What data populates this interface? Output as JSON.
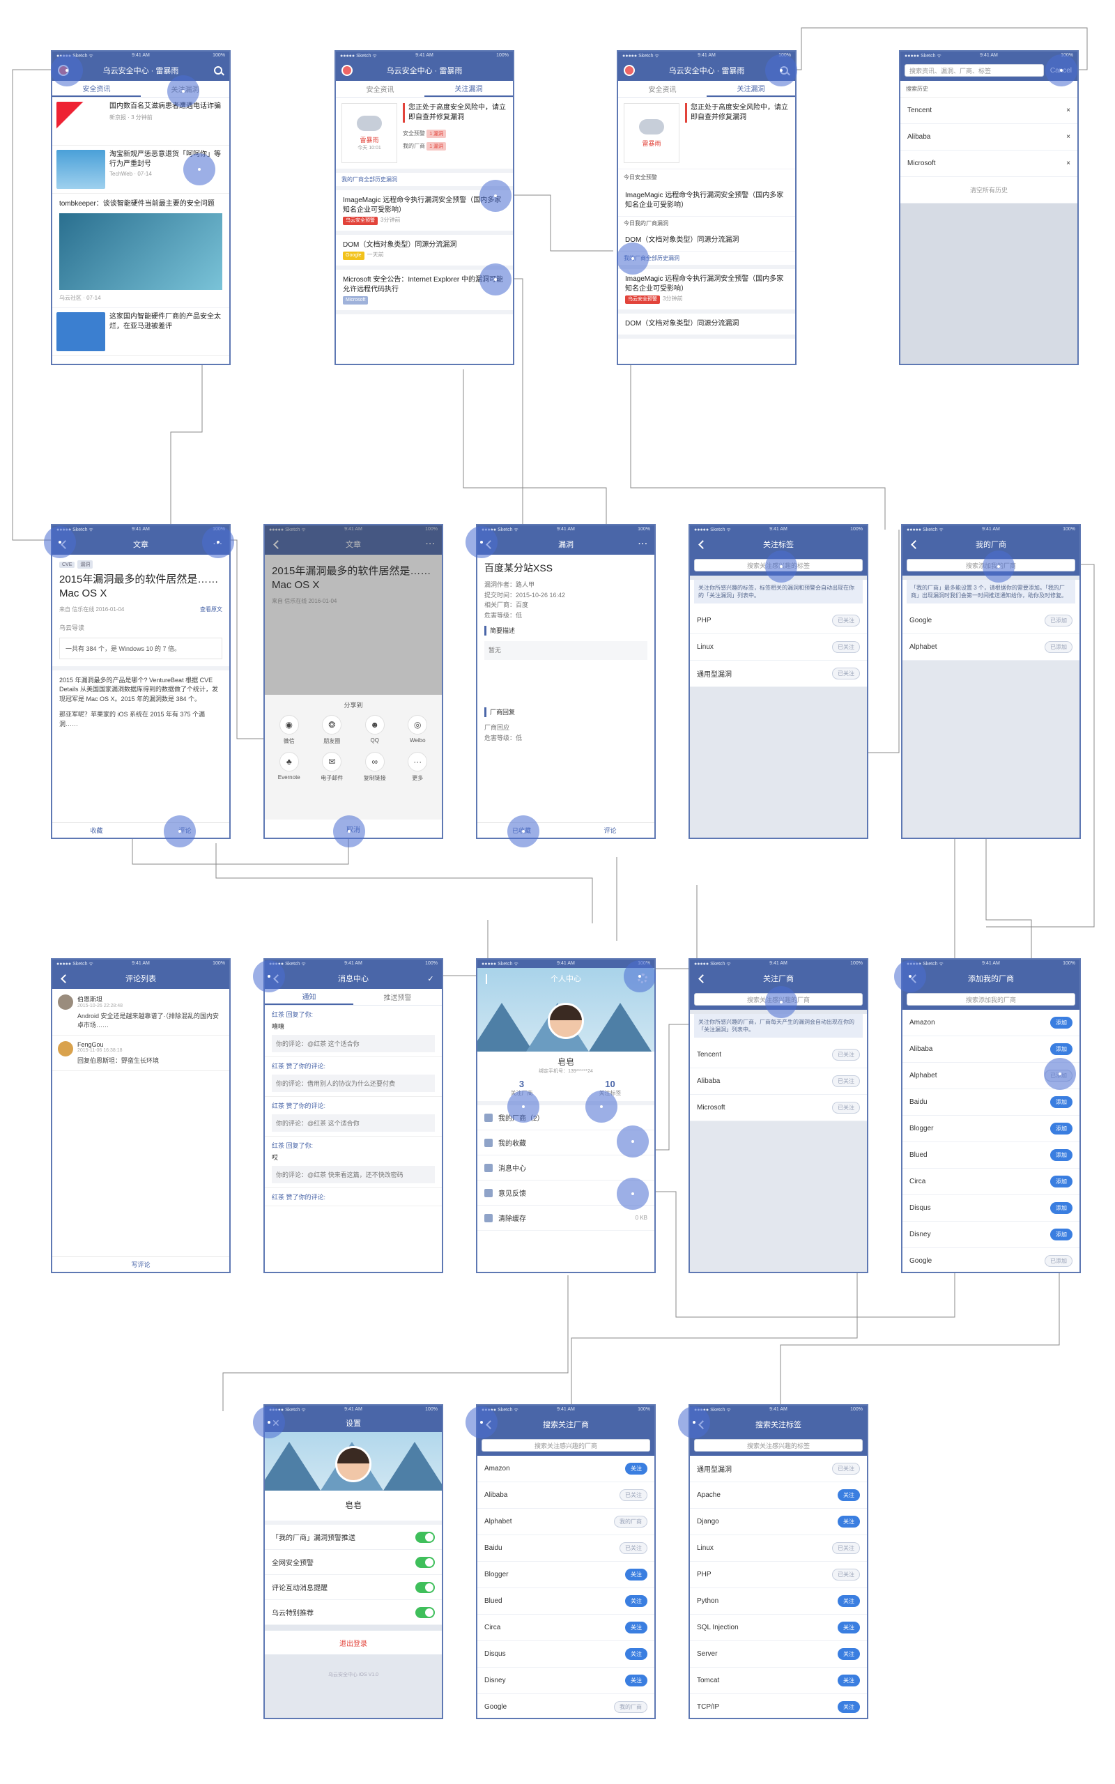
{
  "status": {
    "carrier": "●●●●● Sketch ᯤ",
    "time": "9:41 AM",
    "battery": "100%"
  },
  "home": {
    "title": "乌云安全中心 · 雷暴雨",
    "tabs": [
      "安全资讯",
      "关注漏洞"
    ],
    "feed": [
      {
        "text": "国内数百名艾滋病患者遭遇电话诈骗",
        "meta": "新京报 · 3 分钟前"
      },
      {
        "text": "淘宝新规严惩恶意退货「呵呵你」等行为严重封号",
        "meta": "TechWeb · 07-14"
      },
      {
        "text": "tombkeeper：谈谈智能硬件当前最主要的安全问题",
        "meta": "乌云社区 · 07-14"
      },
      {
        "text": "这家国内智能硬件厂商的产品安全太烂，在亚马逊被差评",
        "meta": ""
      }
    ]
  },
  "watch": {
    "title": "乌云安全中心 · 雷暴雨",
    "tabs": [
      "安全资讯",
      "关注漏洞"
    ],
    "alert": {
      "level": "雷暴雨",
      "date": "今天 10:01",
      "text": "您正处于高度安全风险中，请立即自查并修复漏洞",
      "rows": [
        "安全预警",
        "我的厂商"
      ],
      "badges": [
        "1 漏洞",
        "1 漏洞"
      ]
    },
    "history": "我的厂商全部历史漏洞",
    "items": [
      {
        "title": "ImageMagic 远程命令执行漏洞安全预警（国内多家知名企业可受影响）",
        "tag": "乌云安全预警",
        "time": "3分钟前"
      },
      {
        "title": "DOM（文档对象类型）同源分流漏洞",
        "tag": "Google",
        "time": "一天前"
      },
      {
        "title": "Microsoft 安全公告：Internet Explorer 中的漏洞可能允许远程代码执行",
        "tag": "Microsoft",
        "time": "一天前"
      }
    ],
    "today": "今日安全预警",
    "today2": "今日我的厂商漏洞"
  },
  "search": {
    "placeholder": "搜索资讯、漏洞、厂商、标签",
    "cancel": "Cancel",
    "history_label": "搜索历史",
    "history": [
      "Tencent",
      "Alibaba",
      "Microsoft"
    ],
    "clear": "清空所有历史"
  },
  "article": {
    "title": "文章",
    "tags": [
      "CVE",
      "漏洞"
    ],
    "headline": "2015年漏洞最多的软件居然是……Mac OS X",
    "source": "来自 信乐在线 2016-01-04",
    "view_orig": "查看原文",
    "guide": "乌云导读",
    "quote": "一共有 384 个，是 Windows 10 的 7 倍。",
    "body": "2015 年漏洞最多的产品是哪个? VentureBeat 根据 CVE Details 从美国国家漏洞数据库得到的数据做了个统计，发现冠军是 Mac OS X。2015 年的漏洞数是 384 个。",
    "body2": "那亚军呢？苹果家的 iOS 系统在 2015 年有 375 个漏洞……",
    "fav": "收藏",
    "comment": "评论"
  },
  "share": {
    "title": "分享到",
    "items": [
      "微信",
      "朋友圈",
      "QQ",
      "Weibo",
      "Evernote",
      "电子邮件",
      "复制链接",
      "更多"
    ],
    "cancel": "取消"
  },
  "vuln": {
    "title": "漏洞",
    "name": "百度某分站XSS",
    "author": "漏洞作者：路人甲",
    "time": "提交时间：2015-10-26 16:42",
    "vendor": "相关厂商：百度",
    "level": "危害等级：低",
    "desc_label": "简要描述",
    "desc": "暂无",
    "reply_label": "厂商回复",
    "reply": "厂商回应",
    "level2": "危害等级：低",
    "fav": "已收藏",
    "comment": "评论"
  },
  "tags": {
    "title": "关注标签",
    "search": "搜索关注感兴趣的标签",
    "note": "关注你所感兴趣的标签，标签相关的漏洞和预警会自动出现在你的「关注漏洞」列表中。",
    "rows": [
      {
        "n": "PHP",
        "s": "已关注"
      },
      {
        "n": "Linux",
        "s": "已关注"
      },
      {
        "n": "通用型漏洞",
        "s": "已关注"
      }
    ]
  },
  "vendors": {
    "title": "我的厂商",
    "search": "搜索添加我的厂商",
    "note": "「我的厂商」最多能设置 3 个，请根据你的需要添加。「我的厂商」出现漏洞时我们会第一时间推送通知给你，助你及时修复。",
    "rows": [
      {
        "n": "Google",
        "s": "已添加"
      },
      {
        "n": "Alphabet",
        "s": "已添加"
      }
    ]
  },
  "comments": {
    "title": "评论列表",
    "items": [
      {
        "user": "伯恩斯坦",
        "date": "2015-10-26 22:28:48",
        "text": "Android 安全还是越来越靠谱了·（排除混乱的国内安卓市场……"
      },
      {
        "user": "FengGou",
        "date": "2015-11-06 16:38:18",
        "text": "回复伯恩斯坦：野蛮生长环境"
      }
    ],
    "write": "写评论"
  },
  "messages": {
    "title": "消息中心",
    "tabs": [
      "通知",
      "推送预警"
    ],
    "items": [
      {
        "h": "红茶 回复了你:",
        "r": "嘻嘻",
        "b": "你的评论：@红茶 这个适合你"
      },
      {
        "h": "红茶 赞了你的评论:",
        "r": "",
        "b": "你的评论：借用别人的协议为什么还要付费"
      },
      {
        "h": "红茶 赞了你的评论:",
        "r": "",
        "b": "你的评论：@红茶 这个适合你"
      },
      {
        "h": "红茶 回复了你:",
        "r": "哎",
        "b": "你的评论：@红茶 快来看这篇，还不快改密码"
      },
      {
        "h": "红茶 赞了你的评论:",
        "r": "",
        "b": ""
      }
    ]
  },
  "profile": {
    "title": "个人中心",
    "name": "皂皂",
    "phone": "绑定手机号：139******24",
    "stats": [
      {
        "n": "3",
        "l": "关注厂商"
      },
      {
        "n": "10",
        "l": "关注标签"
      }
    ],
    "menu": [
      "我的厂商（2）",
      "我的收藏",
      "消息中心",
      "意见反馈",
      "清除缓存"
    ],
    "cache": "0 KB"
  },
  "focus_vendors": {
    "title": "关注厂商",
    "search": "搜索关注感兴趣的厂商",
    "note": "关注你所感兴趣的厂商，厂商每天产生的漏洞会自动出现在你的「关注漏洞」列表中。",
    "rows": [
      {
        "n": "Tencent",
        "s": "已关注"
      },
      {
        "n": "Alibaba",
        "s": "已关注"
      },
      {
        "n": "Microsoft",
        "s": "已关注"
      }
    ]
  },
  "add_vendor": {
    "title": "添加我的厂商",
    "search": "搜索添加我的厂商",
    "rows": [
      {
        "n": "Amazon",
        "s": "添加"
      },
      {
        "n": "Alibaba",
        "s": "添加"
      },
      {
        "n": "Alphabet",
        "s": "已添加"
      },
      {
        "n": "Baidu",
        "s": "添加"
      },
      {
        "n": "Blogger",
        "s": "添加"
      },
      {
        "n": "Blued",
        "s": "添加"
      },
      {
        "n": "Circa",
        "s": "添加"
      },
      {
        "n": "Disqus",
        "s": "添加"
      },
      {
        "n": "Disney",
        "s": "添加"
      },
      {
        "n": "Google",
        "s": "已添加"
      }
    ]
  },
  "settings": {
    "title": "设置",
    "name": "皂皂",
    "rows": [
      "「我的厂商」漏洞预警推送",
      "全网安全预警",
      "评论互动消息提醒",
      "乌云特别推荐"
    ],
    "logout": "退出登录",
    "version": "乌云安全中心 iOS V1.0"
  },
  "search_vendor": {
    "title": "搜索关注厂商",
    "search": "搜索关注感兴趣的厂商",
    "rows": [
      {
        "n": "Amazon",
        "s": "关注"
      },
      {
        "n": "Alibaba",
        "s": "已关注"
      },
      {
        "n": "Alphabet",
        "s": "我的厂商"
      },
      {
        "n": "Baidu",
        "s": "已关注"
      },
      {
        "n": "Blogger",
        "s": "关注"
      },
      {
        "n": "Blued",
        "s": "关注"
      },
      {
        "n": "Circa",
        "s": "关注"
      },
      {
        "n": "Disqus",
        "s": "关注"
      },
      {
        "n": "Disney",
        "s": "关注"
      },
      {
        "n": "Google",
        "s": "我的厂商"
      }
    ]
  },
  "search_tag": {
    "title": "搜索关注标签",
    "search": "搜索关注感兴趣的标签",
    "rows": [
      {
        "n": "通用型漏洞",
        "s": "已关注"
      },
      {
        "n": "Apache",
        "s": "关注"
      },
      {
        "n": "Django",
        "s": "关注"
      },
      {
        "n": "Linux",
        "s": "已关注"
      },
      {
        "n": "PHP",
        "s": "已关注"
      },
      {
        "n": "Python",
        "s": "关注"
      },
      {
        "n": "SQL Injection",
        "s": "关注"
      },
      {
        "n": "Server",
        "s": "关注"
      },
      {
        "n": "Tomcat",
        "s": "关注"
      },
      {
        "n": "TCP/IP",
        "s": "关注"
      }
    ]
  },
  "colors": {
    "primary": "#4a66a8",
    "accent": "#3a7ee0",
    "alert": "#e2433a",
    "toggle": "#3fbf5b",
    "highlight": "rgba(74,110,210,.55)"
  }
}
